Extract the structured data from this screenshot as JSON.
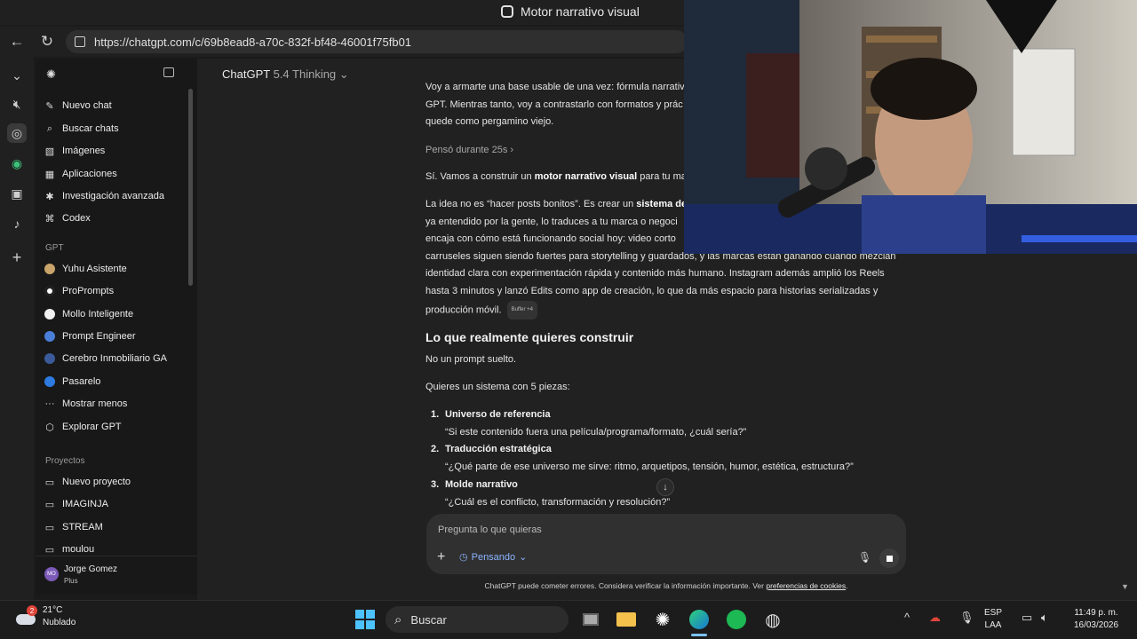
{
  "window": {
    "title": "Motor narrativo visual"
  },
  "browser": {
    "url": "https://chatgpt.com/c/69b8ead8-a70c-832f-bf48-46001f75fb01"
  },
  "sidebar": {
    "top_items": [
      {
        "label": "Nuevo chat",
        "icon": "compose-icon"
      },
      {
        "label": "Buscar chats",
        "icon": "search-icon"
      },
      {
        "label": "Imágenes",
        "icon": "image-icon"
      },
      {
        "label": "Aplicaciones",
        "icon": "grid-icon"
      },
      {
        "label": "Investigación avanzada",
        "icon": "research-icon"
      },
      {
        "label": "Codex",
        "icon": "code-icon"
      }
    ],
    "gpt_section": "GPT",
    "gpts": [
      {
        "label": "Yuhu Asistente",
        "color": "#c9a46b"
      },
      {
        "label": "ProPrompts",
        "color": "#ffffff"
      },
      {
        "label": "Mollo Inteligente",
        "color": "#f1f1f1"
      },
      {
        "label": "Prompt Engineer",
        "color": "#4a7fd8"
      },
      {
        "label": "Cerebro Inmobiliario GA",
        "color": "#3a5a9a"
      },
      {
        "label": "Pasarelo",
        "color": "#2d7be0"
      }
    ],
    "show_less": "Mostrar menos",
    "explore": "Explorar GPT",
    "projects_section": "Proyectos",
    "projects": [
      {
        "label": "Nuevo proyecto"
      },
      {
        "label": "IMAGINJA"
      },
      {
        "label": "STREAM"
      },
      {
        "label": "moulou"
      }
    ],
    "user": {
      "name": "Jorge Gomez",
      "plan": "Plus",
      "initials": "MO"
    }
  },
  "header": {
    "model": "ChatGPT",
    "model_version": "5.4 Thinking"
  },
  "chat": {
    "intro_lines": [
      "Voy a armarte una base usable de una vez: fórmula narrativ",
      "GPT. Mientras tanto, voy a contrastarlo con formatos y prác",
      "quede como pergamino viejo."
    ],
    "thought_label": "Pensó durante 25s",
    "p1_a": "Sí. Vamos a construir un ",
    "p1_b": "motor narrativo visual",
    "p1_c": " para tu ma",
    "p2_l1_a": "La idea no es “hacer posts bonitos”. Es crear un ",
    "p2_l1_b": "sistema de",
    "p2_l2": "ya entendido por la gente, lo traduces a tu marca o negoci",
    "p2_l3": "encaja con cómo está funcionando social hoy: video corto",
    "p2_l4": "carruseles siguen siendo fuertes para storytelling y guardados, y las marcas están ganando cuando mezclan",
    "p2_l5": "identidad clara con experimentación rápida y contenido más humano. Instagram además amplió los Reels",
    "p2_l6": "hasta 3 minutos y lanzó Edits como app de creación, lo que da más espacio para historias serializadas y",
    "p2_l7": "producción móvil.",
    "source_badge": "Buffer +4",
    "h2": "Lo que realmente quieres construir",
    "p3": "No un prompt suelto.",
    "p4": "Quieres un sistema con 5 piezas:",
    "list": [
      {
        "num": "1.",
        "title": "Universo de referencia",
        "sub": "“Si este contenido fuera una película/programa/formato, ¿cuál sería?”"
      },
      {
        "num": "2.",
        "title": "Traducción estratégica",
        "sub": "“¿Qué parte de ese universo me sirve: ritmo, arquetipos, tensión, humor, estética, estructura?”"
      },
      {
        "num": "3.",
        "title": "Molde narrativo",
        "sub": "“¿Cuál es el conflicto, transformación y resolución?”"
      }
    ]
  },
  "composer": {
    "placeholder": "Pregunta lo que quieras",
    "mode": "Pensando"
  },
  "disclaimer": {
    "text": "ChatGPT puede cometer errores. Considera verificar la información importante. Ver ",
    "link": "preferencias de cookies",
    "end": "."
  },
  "taskbar": {
    "weather_temp": "21°C",
    "weather_desc": "Nublado",
    "weather_badge": "2",
    "search": "Buscar",
    "lang_1": "ESP",
    "lang_2": "LAA",
    "time": "11:49 p. m.",
    "date": "16/03/2026"
  }
}
